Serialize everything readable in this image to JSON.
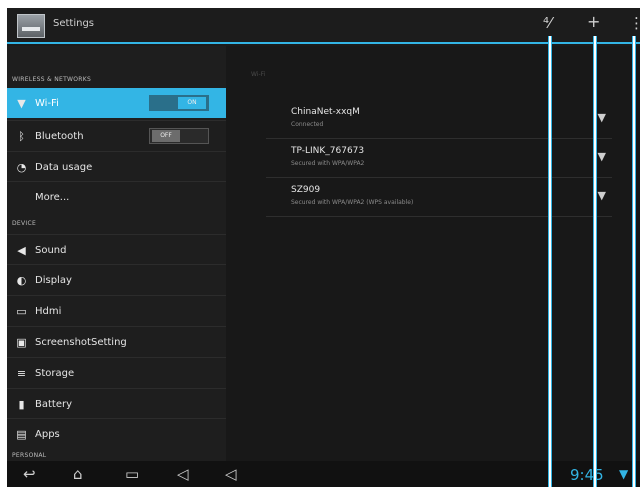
{
  "actionbar": {
    "title": "Settings",
    "icons": [
      "scan-icon",
      "add-network-icon",
      "overflow-menu-icon"
    ]
  },
  "sidebar": {
    "sections": {
      "wireless": "WIRELESS & NETWORKS",
      "device": "DEVICE",
      "personal": "PERSONAL"
    },
    "items": [
      {
        "label": "Wi-Fi",
        "icon": "wifi-icon",
        "toggle": "ON",
        "active": true
      },
      {
        "label": "Bluetooth",
        "icon": "bluetooth-icon",
        "toggle": "OFF"
      },
      {
        "label": "Data usage",
        "icon": "data-usage-icon"
      },
      {
        "label": "More..."
      },
      {
        "label": "Sound",
        "icon": "sound-icon"
      },
      {
        "label": "Display",
        "icon": "display-icon"
      },
      {
        "label": "Hdmi",
        "icon": "hdmi-icon"
      },
      {
        "label": "ScreenshotSetting",
        "icon": "screenshot-icon"
      },
      {
        "label": "Storage",
        "icon": "storage-icon"
      },
      {
        "label": "Battery",
        "icon": "battery-icon"
      },
      {
        "label": "Apps",
        "icon": "apps-icon"
      }
    ]
  },
  "main": {
    "header": "Wi-Fi",
    "networks": [
      {
        "name": "ChinaNet-xxqM",
        "status": "Connected"
      },
      {
        "name": "TP-LINK_767673",
        "status": "Secured with WPA/WPA2"
      },
      {
        "name": "SZ909",
        "status": "Secured with WPA/WPA2 (WPS available)"
      }
    ]
  },
  "statusbar": {
    "time": "9:45"
  },
  "colors": {
    "accent": "#33b5e5",
    "background": "#1b1b1b"
  }
}
